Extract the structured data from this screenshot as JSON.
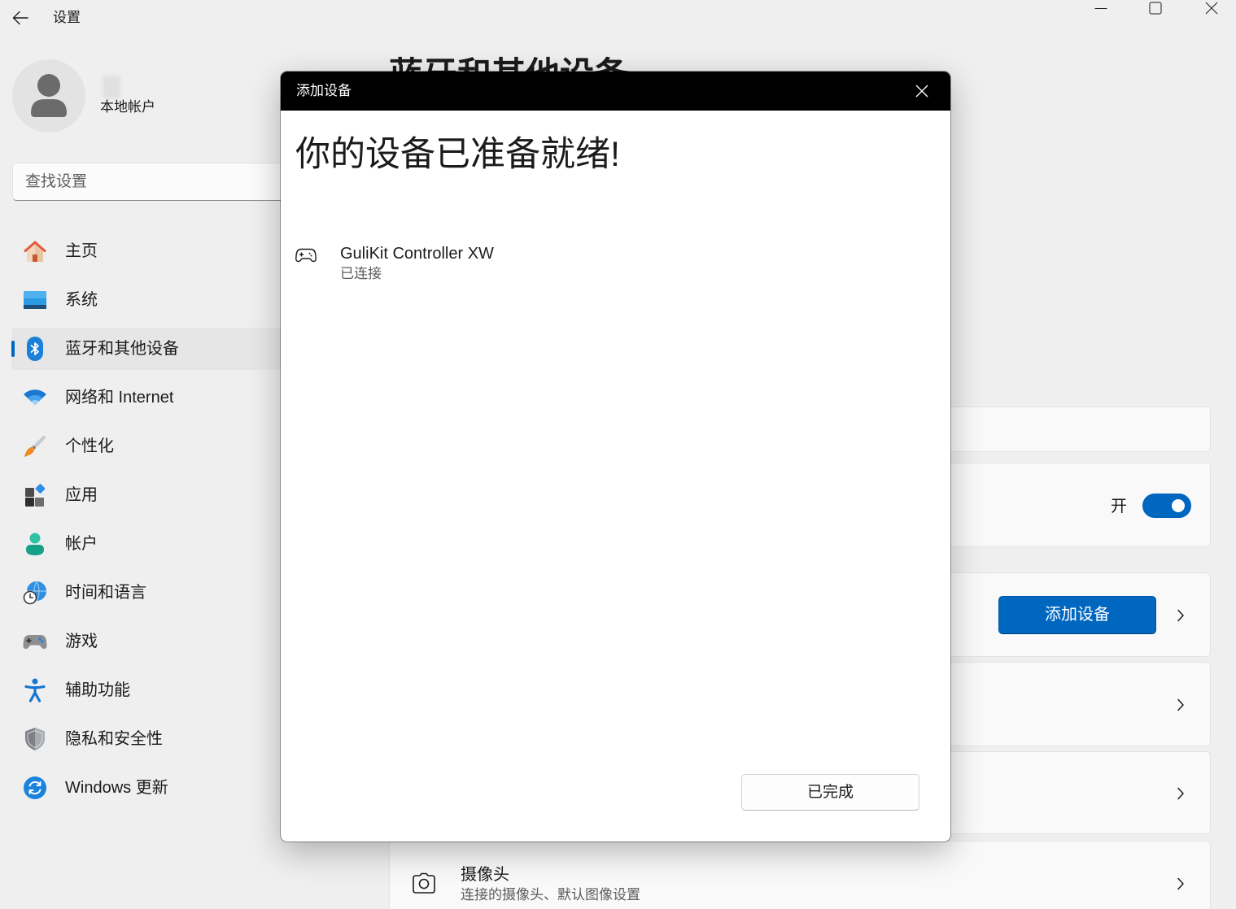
{
  "theme": {
    "accent": "#0067c0",
    "background": "#efefef"
  },
  "window": {
    "title": "设置",
    "back_icon": "back-arrow-icon",
    "control_icons": [
      "minimize-icon",
      "maximize-icon",
      "close-icon"
    ]
  },
  "profile": {
    "account_type": "本地帐户",
    "avatar_icon": "person-icon"
  },
  "search": {
    "placeholder": "查找设置"
  },
  "nav": {
    "items": [
      {
        "label": "主页",
        "icon": "home-icon",
        "selected": false
      },
      {
        "label": "系统",
        "icon": "system-display-icon",
        "selected": false
      },
      {
        "label": "蓝牙和其他设备",
        "icon": "bluetooth-icon",
        "selected": true
      },
      {
        "label": "网络和 Internet",
        "icon": "wifi-icon",
        "selected": false
      },
      {
        "label": "个性化",
        "icon": "paintbrush-icon",
        "selected": false
      },
      {
        "label": "应用",
        "icon": "apps-icon",
        "selected": false
      },
      {
        "label": "帐户",
        "icon": "account-icon",
        "selected": false
      },
      {
        "label": "时间和语言",
        "icon": "globe-clock-icon",
        "selected": false
      },
      {
        "label": "游戏",
        "icon": "gamepad-icon",
        "selected": false
      },
      {
        "label": "辅助功能",
        "icon": "accessibility-icon",
        "selected": false
      },
      {
        "label": "隐私和安全性",
        "icon": "shield-icon",
        "selected": false
      },
      {
        "label": "Windows 更新",
        "icon": "windows-update-icon",
        "selected": false
      }
    ]
  },
  "page": {
    "title": "蓝牙和其他设备"
  },
  "content": {
    "bluetooth": {
      "state_label": "开",
      "on": true
    },
    "devices": {
      "add_button": "添加设备"
    },
    "camera": {
      "title": "摄像头",
      "subtitle": "连接的摄像头、默认图像设置",
      "icon": "camera-icon"
    }
  },
  "dialog": {
    "title": "添加设备",
    "heading": "你的设备已准备就绪!",
    "device": {
      "name": "GuliKit Controller XW",
      "status": "已连接",
      "icon": "gamepad-outline-icon"
    },
    "done_button": "已完成"
  }
}
